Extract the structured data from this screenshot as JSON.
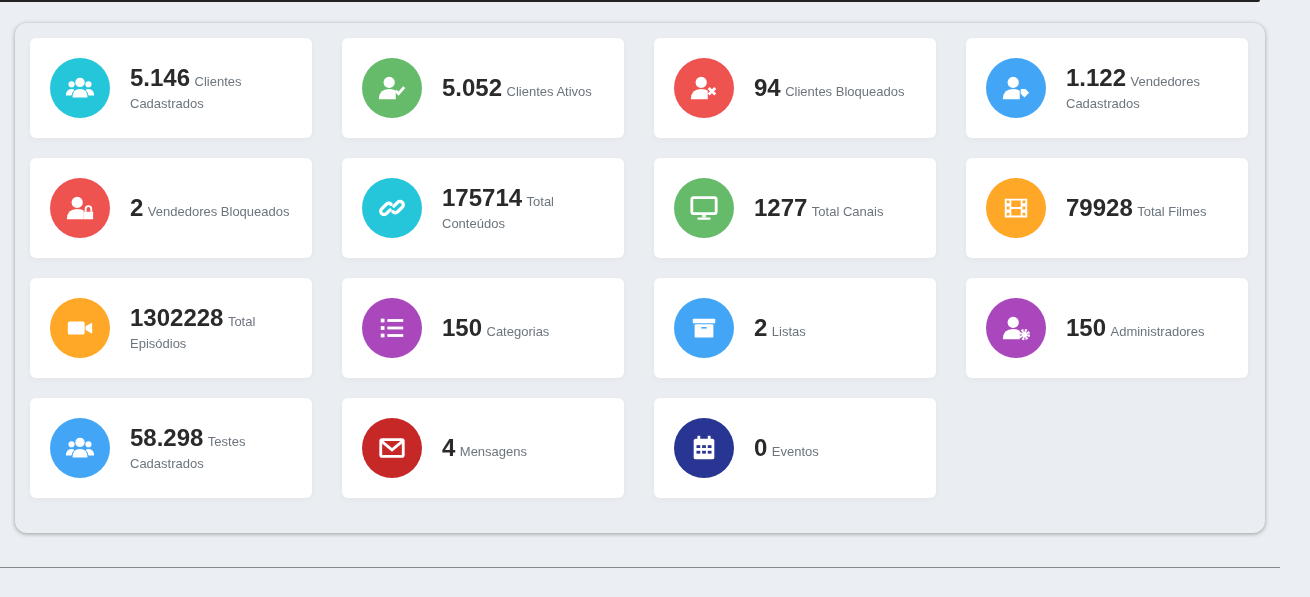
{
  "stats": [
    {
      "value": "5.146",
      "label": "Clientes Cadastrados",
      "kind": "users",
      "color": "#26c6da"
    },
    {
      "value": "5.052",
      "label": "Clientes Ativos",
      "kind": "user-check",
      "color": "#66bb6a"
    },
    {
      "value": "94",
      "label": "Clientes Bloqueados",
      "kind": "user-x",
      "color": "#ef5350"
    },
    {
      "value": "1.122",
      "label": "Vendedores Cadastrados",
      "kind": "user-tag",
      "color": "#42a5f5"
    },
    {
      "value": "2",
      "label": "Vendedores Bloqueados",
      "kind": "user-lock",
      "color": "#ef5350"
    },
    {
      "value": "175714",
      "label": "Total Conteúdos",
      "kind": "link",
      "color": "#26c6da"
    },
    {
      "value": "1277",
      "label": "Total Canais",
      "kind": "monitor",
      "color": "#66bb6a"
    },
    {
      "value": "79928",
      "label": "Total Filmes",
      "kind": "film",
      "color": "#ffa726"
    },
    {
      "value": "1302228",
      "label": "Total Episódios",
      "kind": "video",
      "color": "#ffa726"
    },
    {
      "value": "150",
      "label": "Categorias",
      "kind": "list",
      "color": "#ab47bc"
    },
    {
      "value": "2",
      "label": "Listas",
      "kind": "archive",
      "color": "#42a5f5"
    },
    {
      "value": "150",
      "label": "Administradores",
      "kind": "user-gear",
      "color": "#ab47bc"
    },
    {
      "value": "58.298",
      "label": "Testes Cadastrados",
      "kind": "users",
      "color": "#42a5f5"
    },
    {
      "value": "4",
      "label": "Mensagens",
      "kind": "envelope",
      "color": "#c62828"
    },
    {
      "value": "0",
      "label": "Eventos",
      "kind": "calendar",
      "color": "#283593"
    }
  ]
}
